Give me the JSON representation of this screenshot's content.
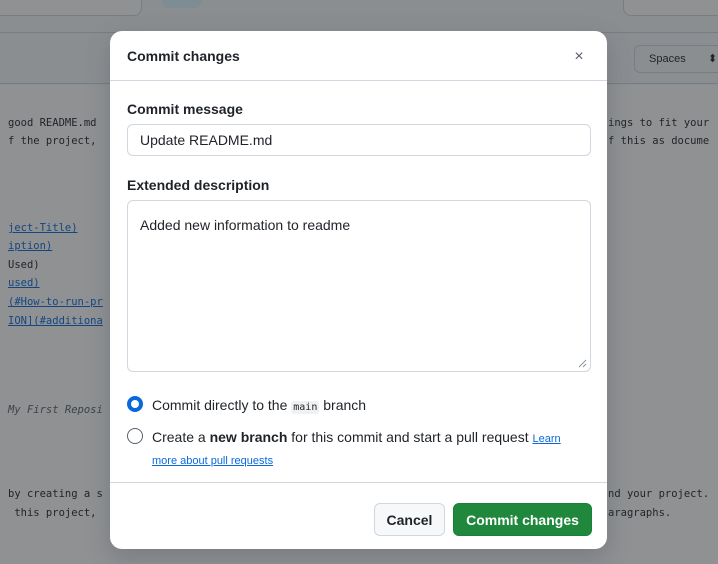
{
  "background": {
    "spaces_label": "Spaces",
    "left_lines": [
      {
        "text": "good README.md",
        "style": "normal"
      },
      {
        "text": "f the project,",
        "style": "normal"
      },
      {
        "text": "ject-Title)",
        "style": "link"
      },
      {
        "text": "iption)",
        "style": "link"
      },
      {
        "text": "Used)",
        "style": "normal"
      },
      {
        "text": "used)",
        "style": "link"
      },
      {
        "text": "(#How-to-run-pr",
        "style": "link"
      },
      {
        "text": "ION](#additiona",
        "style": "link"
      },
      {
        "text": "My First Reposi",
        "style": "italic"
      },
      {
        "text": "by creating a s",
        "style": "normal"
      },
      {
        "text": " this project,",
        "style": "normal"
      }
    ],
    "right_lines": [
      "ings to fit your",
      "f this as docume",
      "nd your project.",
      "aragraphs."
    ]
  },
  "dialog": {
    "title": "Commit changes",
    "close_icon": "×",
    "commit_message_label": "Commit message",
    "commit_message_value": "Update README.md",
    "extended_description_label": "Extended description",
    "extended_description_value": "Added new information to readme",
    "options": {
      "direct": {
        "prefix": "Commit directly to the ",
        "branch": "main",
        "suffix": " branch",
        "selected": true
      },
      "new_branch": {
        "prefix": "Create a ",
        "bold": "new branch",
        "suffix": " for this commit and start a pull request ",
        "link": "Learn more about pull requests",
        "selected": false
      }
    },
    "cancel_label": "Cancel",
    "commit_label": "Commit changes"
  },
  "colors": {
    "accent": "#0969da",
    "primary_button": "#1f883d",
    "overlay": "rgba(31,35,40,0.5)"
  }
}
